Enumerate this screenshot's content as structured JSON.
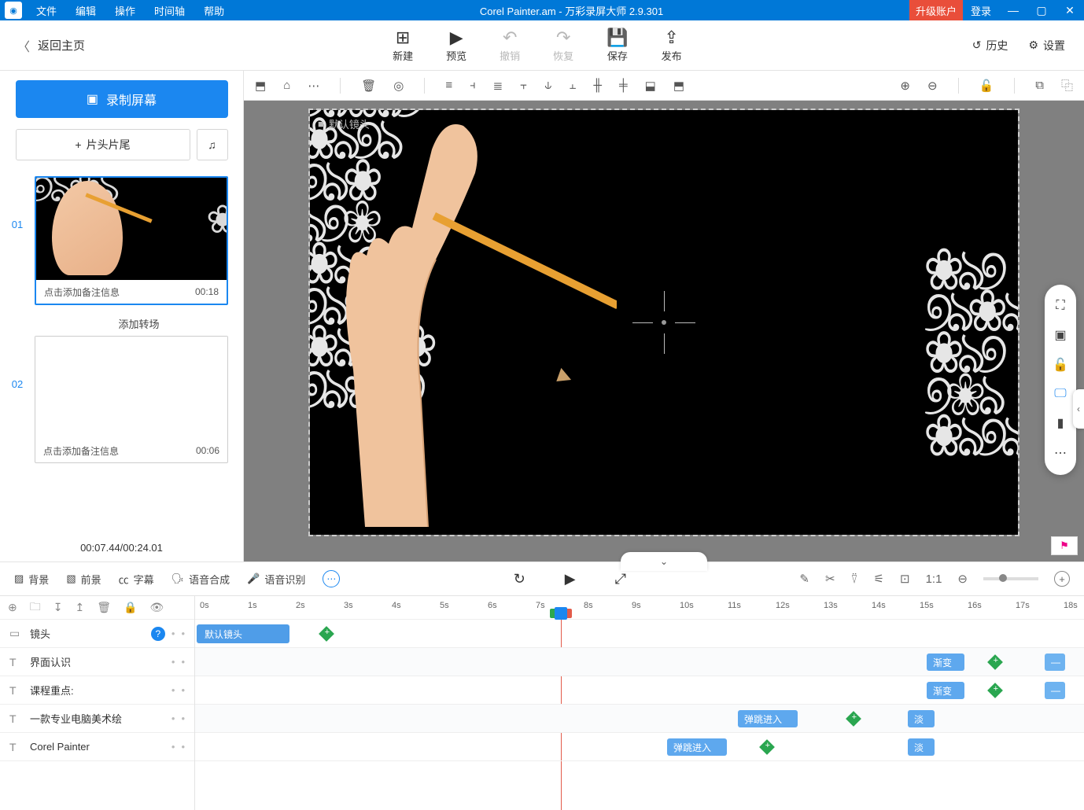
{
  "titlebar": {
    "menus": [
      "文件",
      "编辑",
      "操作",
      "时间轴",
      "帮助"
    ],
    "title": "Corel Painter.am - 万彩录屏大师 2.9.301",
    "upgrade": "升级账户",
    "login": "登录"
  },
  "toolbar": {
    "back": "返回主页",
    "buttons": [
      {
        "label": "新建",
        "disabled": false
      },
      {
        "label": "预览",
        "disabled": false
      },
      {
        "label": "撤销",
        "disabled": true
      },
      {
        "label": "恢复",
        "disabled": true
      },
      {
        "label": "保存",
        "disabled": false
      },
      {
        "label": "发布",
        "disabled": false
      }
    ],
    "history": "历史",
    "settings": "设置"
  },
  "sidebar": {
    "record": "录制屏幕",
    "addClip": "片头片尾",
    "slides": [
      {
        "num": "01",
        "note": "点击添加备注信息",
        "time": "00:18",
        "selected": true,
        "thumb": "hand"
      },
      {
        "num": "02",
        "note": "点击添加备注信息",
        "time": "00:06",
        "selected": false,
        "thumb": "blank"
      }
    ],
    "transition": "添加转场",
    "time": "00:07.44/00:24.01"
  },
  "canvas": {
    "stageLabel": "默认镜头"
  },
  "timelineTabs": {
    "items": [
      "背景",
      "前景",
      "字幕",
      "语音合成",
      "语音识别"
    ]
  },
  "ruler": [
    "0s",
    "1s",
    "2s",
    "3s",
    "4s",
    "5s",
    "6s",
    "7s",
    "8s",
    "9s",
    "10s",
    "11s",
    "12s",
    "13s",
    "14s",
    "15s",
    "16s",
    "17s",
    "18s"
  ],
  "tracks": [
    {
      "icon": "▭",
      "label": "镜头",
      "help": true
    },
    {
      "icon": "T",
      "label": "界面认识"
    },
    {
      "icon": "T",
      "label": "课程重点:"
    },
    {
      "icon": "T",
      "label": "一款专业电脑美术绘"
    },
    {
      "icon": "T",
      "label": "Corel Painter"
    }
  ],
  "clips": {
    "defaultCam": "默认镜头",
    "gradient": "渐变",
    "bounceIn": "弹跳进入",
    "fade": "淡"
  },
  "playheadX": 465
}
